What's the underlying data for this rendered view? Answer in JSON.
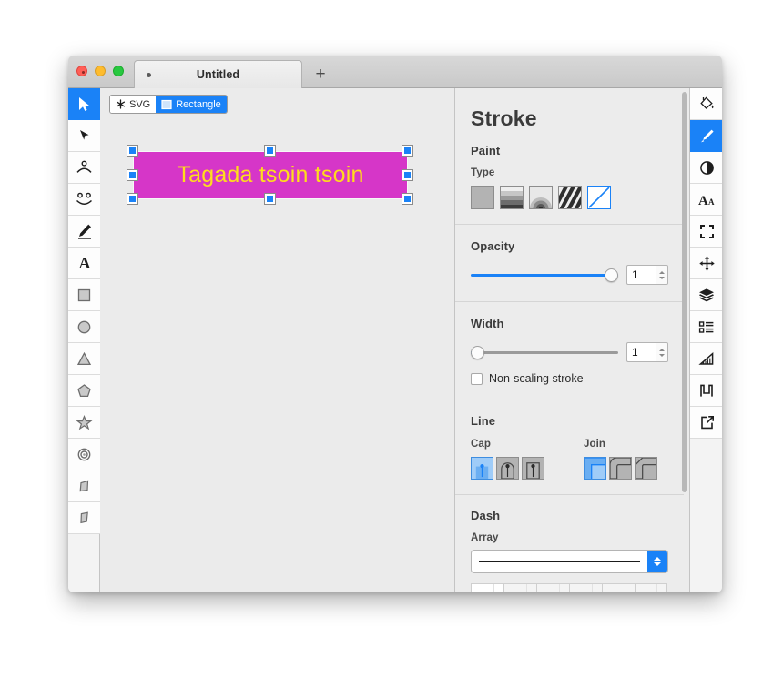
{
  "window": {
    "title": "Untitled",
    "traffic_lights": [
      "close",
      "minimize",
      "zoom"
    ],
    "new_tab_label": "+",
    "modified_indicator": "•"
  },
  "breadcrumb": [
    {
      "label": "SVG",
      "icon": "asterisk-icon",
      "selected": false
    },
    {
      "label": "Rectangle",
      "icon": "rectangle-icon",
      "selected": true
    }
  ],
  "canvas": {
    "shape_text": "Tagada tsoin tsoin",
    "shape_fill": "#d636c8",
    "text_color": "#ffdd1c",
    "handle_color": "#1a82f7",
    "handle_count": 8
  },
  "left_toolbar": [
    {
      "name": "select-tool",
      "icon": "cursor-arrow-icon",
      "active": true
    },
    {
      "name": "node-select-tool",
      "icon": "solid-arrow-icon",
      "active": false
    },
    {
      "name": "node-edit-tool",
      "icon": "single-node-icon",
      "active": false
    },
    {
      "name": "multi-node-tool",
      "icon": "double-node-icon",
      "active": false
    },
    {
      "name": "pencil-tool",
      "icon": "pencil-icon",
      "active": false
    },
    {
      "name": "text-tool",
      "icon": "text-a-icon",
      "active": false
    },
    {
      "name": "rectangle-tool",
      "icon": "square-icon",
      "active": false
    },
    {
      "name": "ellipse-tool",
      "icon": "circle-icon",
      "active": false
    },
    {
      "name": "triangle-tool",
      "icon": "triangle-icon",
      "active": false
    },
    {
      "name": "pentagon-tool",
      "icon": "pentagon-icon",
      "active": false
    },
    {
      "name": "star-tool",
      "icon": "star-icon",
      "active": false
    },
    {
      "name": "spiral-tool",
      "icon": "concentric-circles-icon",
      "active": false
    },
    {
      "name": "polygon-tool",
      "icon": "quad-shape-icon",
      "active": false
    },
    {
      "name": "freeform-tool",
      "icon": "quad-shape-alt-icon",
      "active": false
    }
  ],
  "right_toolbar": [
    {
      "name": "fill-panel",
      "icon": "paint-bucket-icon",
      "active": false
    },
    {
      "name": "stroke-panel",
      "icon": "brush-icon",
      "active": true
    },
    {
      "name": "filters-panel",
      "icon": "contrast-circle-icon",
      "active": false
    },
    {
      "name": "typography-panel",
      "icon": "text-aa-icon",
      "active": false
    },
    {
      "name": "frame-panel",
      "icon": "crop-corners-icon",
      "active": false
    },
    {
      "name": "transform-panel",
      "icon": "move-arrows-icon",
      "active": false
    },
    {
      "name": "layers-panel",
      "icon": "layers-stack-icon",
      "active": false
    },
    {
      "name": "document-panel",
      "icon": "list-icon",
      "active": false
    },
    {
      "name": "geometry-panel",
      "icon": "set-square-icon",
      "active": false
    },
    {
      "name": "markers-panel",
      "icon": "markers-icon",
      "active": false
    },
    {
      "name": "export-panel",
      "icon": "export-arrow-icon",
      "active": false
    }
  ],
  "stroke_panel": {
    "title": "Stroke",
    "paint": {
      "heading": "Paint",
      "type_label": "Type",
      "types": [
        {
          "name": "flat-color",
          "selected": false
        },
        {
          "name": "linear-gradient",
          "selected": false
        },
        {
          "name": "radial-gradient",
          "selected": false
        },
        {
          "name": "pattern",
          "selected": false
        },
        {
          "name": "none",
          "selected": true
        }
      ]
    },
    "opacity": {
      "heading": "Opacity",
      "value": "1",
      "slider_percent": 100
    },
    "width": {
      "heading": "Width",
      "value": "1",
      "slider_percent": 0,
      "non_scaling_label": "Non-scaling stroke",
      "non_scaling_checked": false
    },
    "line": {
      "heading": "Line",
      "cap_label": "Cap",
      "caps": [
        {
          "name": "butt-cap",
          "selected": true
        },
        {
          "name": "round-cap",
          "selected": false
        },
        {
          "name": "square-cap",
          "selected": false
        }
      ],
      "join_label": "Join",
      "joins": [
        {
          "name": "miter-join",
          "selected": true
        },
        {
          "name": "round-join",
          "selected": false
        },
        {
          "name": "bevel-join",
          "selected": false
        }
      ]
    },
    "dash": {
      "heading": "Dash",
      "array_label": "Array",
      "array_value": "",
      "cells": [
        {
          "value": "",
          "enabled": true,
          "bar": "dark"
        },
        {
          "value": "",
          "enabled": false,
          "bar": "light"
        },
        {
          "value": "",
          "enabled": false,
          "bar": "dark"
        },
        {
          "value": "",
          "enabled": false,
          "bar": "light"
        },
        {
          "value": "",
          "enabled": false,
          "bar": "dark"
        },
        {
          "value": "",
          "enabled": false,
          "bar": "light"
        }
      ]
    }
  }
}
